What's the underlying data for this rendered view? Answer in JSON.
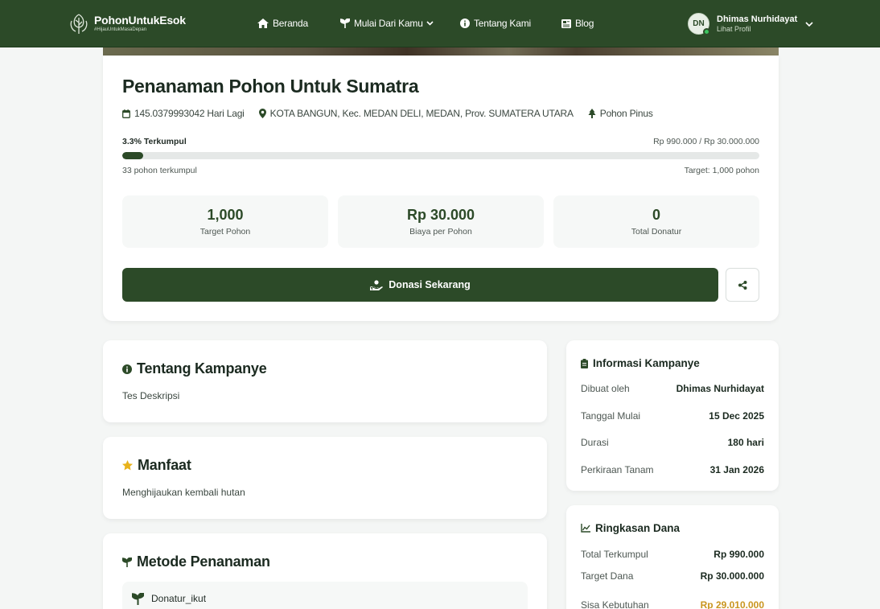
{
  "nav": {
    "brand_name": "PohonUntukEsok",
    "brand_tagline": "#HijauUntukMasaDepan",
    "links": [
      {
        "label": "Beranda",
        "icon": "home-icon"
      },
      {
        "label": "Mulai Dari Kamu",
        "icon": "sprout-icon"
      },
      {
        "label": "Tentang Kami",
        "icon": "info-icon"
      },
      {
        "label": "Blog",
        "icon": "newspaper-icon"
      }
    ],
    "user": {
      "initials": "DN",
      "name": "Dhimas Nurhidayat",
      "subtitle": "Lihat Profil"
    }
  },
  "campaign": {
    "title": "Penanaman Pohon Untuk Sumatra",
    "days_left": "145.0379993042 Hari Lagi",
    "location": "KOTA BANGUN, Kec. MEDAN DELI, MEDAN, Prov. SUMATERA UTARA",
    "tree_type": "Pohon Pinus",
    "progress_label": "3.3% Terkumpul",
    "progress_percent": 3.3,
    "progress_amount": "Rp 990.000 / Rp 30.000.000",
    "trees_collected": "33 pohon terkumpul",
    "target_label": "Target: 1,000 pohon",
    "stats": [
      {
        "value": "1,000",
        "label": "Target Pohon"
      },
      {
        "value": "Rp 30.000",
        "label": "Biaya per Pohon"
      },
      {
        "value": "0",
        "label": "Total Donatur"
      }
    ],
    "donate_label": "Donasi Sekarang"
  },
  "about": {
    "title": "Tentang Kampanye",
    "body": "Tes Deskripsi"
  },
  "benefits": {
    "title": "Manfaat",
    "body": "Menghijaukan kembali hutan"
  },
  "method": {
    "title": "Metode Penanaman",
    "items": [
      "Donatur_ikut"
    ]
  },
  "info": {
    "title": "Informasi Kampanye",
    "rows": [
      {
        "key": "Dibuat oleh",
        "value": "Dhimas Nurhidayat"
      },
      {
        "key": "Tanggal Mulai",
        "value": "15 Dec 2025"
      },
      {
        "key": "Durasi",
        "value": "180 hari"
      },
      {
        "key": "Perkiraan Tanam",
        "value": "31 Jan 2026"
      }
    ]
  },
  "funds": {
    "title": "Ringkasan Dana",
    "rows": [
      {
        "key": "Total Terkumpul",
        "value": "Rp 990.000"
      },
      {
        "key": "Target Dana",
        "value": "Rp 30.000.000"
      },
      {
        "key": "Sisa Kebutuhan",
        "value": "Rp 29.010.000"
      }
    ]
  },
  "colors": {
    "primary": "#2c4a28",
    "accent_gold": "#c9951f",
    "star": "#e8b21a",
    "online": "#3cc45f"
  }
}
